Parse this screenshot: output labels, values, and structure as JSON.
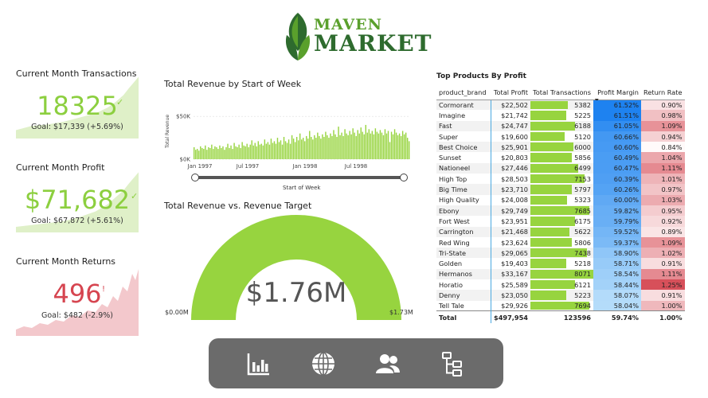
{
  "logo": {
    "line1": "MAVEN",
    "line2": "MARKET"
  },
  "kpis": {
    "transactions": {
      "title": "Current Month Transactions",
      "value": "18325",
      "goal": "Goal: $17,339 (+5.69%)",
      "status_color": "#8ccf3f",
      "trend_glyph": "✓"
    },
    "profit": {
      "title": "Current Month Profit",
      "value": "$71,682",
      "goal": "Goal: $67,872 (+5.61%)",
      "status_color": "#8ccf3f",
      "trend_glyph": "✓"
    },
    "returns": {
      "title": "Current Month Returns",
      "value": "496",
      "goal": "Goal: $482 (-2.9%)",
      "status_color": "#d64550",
      "trend_glyph": "!"
    }
  },
  "revenue_chart": {
    "title": "Total Revenue by Start of Week",
    "chart_data": {
      "type": "bar",
      "title": "Total Revenue by Start of Week",
      "xlabel": "Start of Week",
      "ylabel": "Total Revenue",
      "yticks": [
        "$0K",
        "$50K"
      ],
      "xticks": [
        "Jan 1997",
        "Jul 1997",
        "Jan 1998",
        "Jul 1998"
      ],
      "ylim": [
        0,
        65
      ],
      "values": [
        14,
        11,
        12,
        10,
        15,
        13,
        12,
        16,
        11,
        14,
        13,
        17,
        12,
        15,
        14,
        12,
        16,
        13,
        15,
        11,
        14,
        18,
        13,
        16,
        12,
        19,
        15,
        14,
        17,
        13,
        20,
        16,
        15,
        18,
        14,
        17,
        22,
        16,
        19,
        15,
        21,
        17,
        18,
        16,
        23,
        18,
        20,
        17,
        24,
        19,
        21,
        18,
        25,
        20,
        22,
        17,
        26,
        21,
        19,
        23,
        18,
        28,
        24,
        20,
        26,
        22,
        30,
        23,
        25,
        21,
        27,
        24,
        33,
        26,
        23,
        28,
        25,
        31,
        27,
        24,
        29,
        26,
        32,
        28,
        25,
        30,
        27,
        34,
        29,
        26,
        38,
        28,
        31,
        27,
        35,
        30,
        28,
        33,
        29,
        36,
        31,
        27,
        34,
        30,
        37,
        32,
        29,
        40,
        31,
        35,
        30,
        33,
        29,
        36,
        32,
        30,
        34,
        31,
        28,
        35,
        30,
        33,
        20,
        32,
        29,
        35,
        31,
        28,
        30,
        27,
        33,
        29,
        31,
        25,
        21
      ]
    },
    "slider_label": "Start of Week"
  },
  "gauge": {
    "title": "Total Revenue vs. Revenue Target",
    "value": "$1.76M",
    "min": "$0.00M",
    "max": "$1.73M",
    "fill_fraction": 1.0,
    "color": "#97d43f"
  },
  "table": {
    "title": "Top Products By Profit",
    "headers": [
      "product_brand",
      "Total Profit",
      "Total Transactions",
      "Profit Margin",
      "Return Rate"
    ],
    "rows": [
      [
        "Cormorant",
        "$22,502",
        5382,
        "61.52%",
        "0.90%"
      ],
      [
        "Imagine",
        "$21,742",
        5225,
        "61.51%",
        "0.98%"
      ],
      [
        "Fast",
        "$24,747",
        6188,
        "61.05%",
        "1.09%"
      ],
      [
        "Super",
        "$19,600",
        5120,
        "60.66%",
        "0.94%"
      ],
      [
        "Best Choice",
        "$25,901",
        6000,
        "60.60%",
        "0.84%"
      ],
      [
        "Sunset",
        "$20,803",
        5856,
        "60.49%",
        "1.04%"
      ],
      [
        "Nationeel",
        "$27,446",
        6499,
        "60.47%",
        "1.11%"
      ],
      [
        "High Top",
        "$28,503",
        7153,
        "60.39%",
        "1.01%"
      ],
      [
        "Big Time",
        "$23,710",
        5797,
        "60.26%",
        "0.97%"
      ],
      [
        "High Quality",
        "$24,008",
        5323,
        "60.00%",
        "1.03%"
      ],
      [
        "Ebony",
        "$29,749",
        7685,
        "59.82%",
        "0.95%"
      ],
      [
        "Fort West",
        "$23,951",
        6175,
        "59.79%",
        "0.92%"
      ],
      [
        "Carrington",
        "$21,468",
        5622,
        "59.52%",
        "0.89%"
      ],
      [
        "Red Wing",
        "$23,624",
        5806,
        "59.37%",
        "1.09%"
      ],
      [
        "Tri-State",
        "$29,065",
        7438,
        "58.90%",
        "1.02%"
      ],
      [
        "Golden",
        "$19,403",
        5218,
        "58.71%",
        "0.91%"
      ],
      [
        "Hermanos",
        "$33,167",
        8071,
        "58.54%",
        "1.11%"
      ],
      [
        "Horatio",
        "$25,589",
        6121,
        "58.44%",
        "1.25%"
      ],
      [
        "Denny",
        "$23,050",
        5223,
        "58.07%",
        "0.91%"
      ],
      [
        "Tell Tale",
        "$29,926",
        7694,
        "58.04%",
        "1.00%"
      ]
    ],
    "totals": [
      "Total",
      "$497,954",
      "123596",
      "59.74%",
      "1.00%"
    ]
  },
  "nav": {
    "items": [
      "bar-chart-icon",
      "globe-icon",
      "users-icon",
      "hierarchy-icon"
    ],
    "color": "#6b6b6b"
  }
}
